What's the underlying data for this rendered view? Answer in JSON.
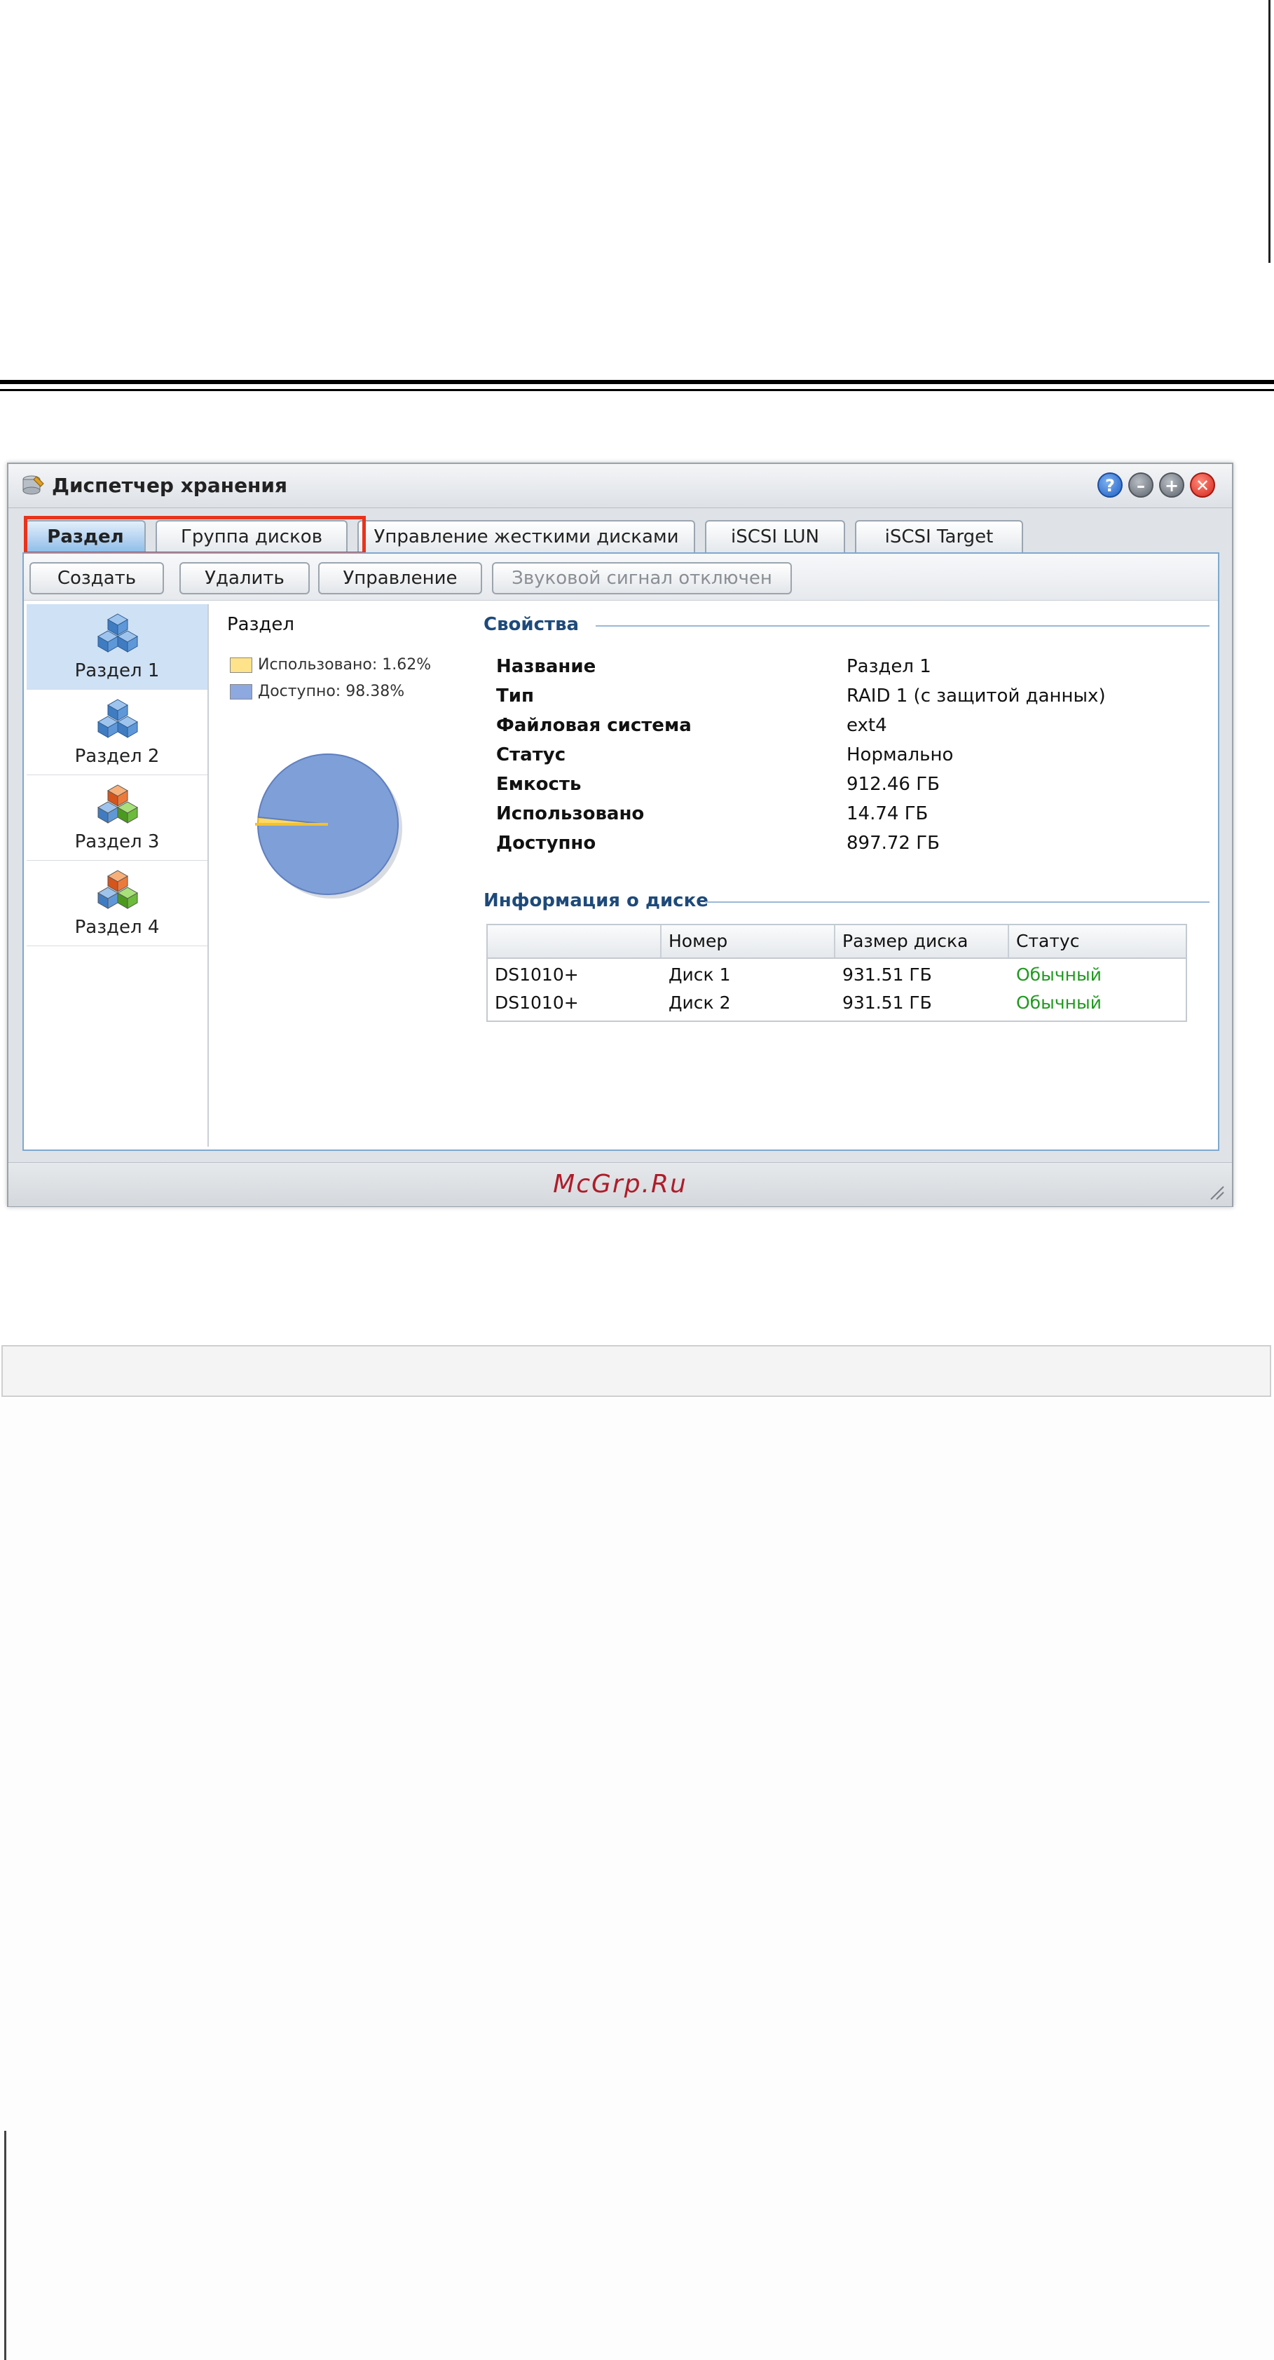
{
  "window": {
    "title": "Диспетчер хранения",
    "controls": [
      "?",
      "–",
      "+",
      "✕"
    ]
  },
  "tabs": [
    {
      "label": "Раздел",
      "active": true
    },
    {
      "label": "Группа дисков",
      "active": false
    },
    {
      "label": "Управление жесткими дисками",
      "active": false
    },
    {
      "label": "iSCSI LUN",
      "active": false
    },
    {
      "label": "iSCSI Target",
      "active": false
    }
  ],
  "toolbar": {
    "create": "Создать",
    "delete": "Удалить",
    "manage": "Управление",
    "beep_off": "Звуковой сигнал отключен"
  },
  "sidebar": {
    "items": [
      {
        "label": "Раздел 1",
        "selected": true,
        "icon": "blue-cubes-icon"
      },
      {
        "label": "Раздел 2",
        "selected": false,
        "icon": "blue-cubes-icon"
      },
      {
        "label": "Раздел 3",
        "selected": false,
        "icon": "multicolor-cubes-icon"
      },
      {
        "label": "Раздел 4",
        "selected": false,
        "icon": "multicolor-cubes-icon"
      }
    ]
  },
  "chart": {
    "title": "Раздел",
    "legend_used": "Использовано: 1.62%",
    "legend_free": "Доступно: 98.38%"
  },
  "chart_data": {
    "type": "pie",
    "categories": [
      "Использовано",
      "Доступно"
    ],
    "values": [
      1.62,
      98.38
    ],
    "colors": [
      "#ffd966",
      "#7f9fd8"
    ]
  },
  "properties": {
    "title": "Свойства",
    "rows": [
      {
        "label": "Название",
        "value": "Раздел 1"
      },
      {
        "label": "Тип",
        "value": "RAID 1 (с защитой данных)"
      },
      {
        "label": "Файловая система",
        "value": "ext4"
      },
      {
        "label": "Статус",
        "value": "Нормально"
      },
      {
        "label": "Емкость",
        "value": "912.46 ГБ"
      },
      {
        "label": "Использовано",
        "value": "14.74 ГБ"
      },
      {
        "label": "Доступно",
        "value": "897.72 ГБ"
      }
    ]
  },
  "disk_info": {
    "title": "Информация о диске",
    "headers": [
      "",
      "Номер",
      "Размер диска",
      "Статус"
    ],
    "rows": [
      [
        "DS1010+",
        "Диск 1",
        "931.51 ГБ",
        "Обычный"
      ],
      [
        "DS1010+",
        "Диск 2",
        "931.51 ГБ",
        "Обычный"
      ]
    ]
  },
  "statusbar": {
    "brand": "McGrp.Ru"
  },
  "colors": {
    "accent": "#1e4a7a",
    "highlight": "#e8341c",
    "status_ok": "#1f9a1f",
    "brand": "#b01c2a"
  }
}
